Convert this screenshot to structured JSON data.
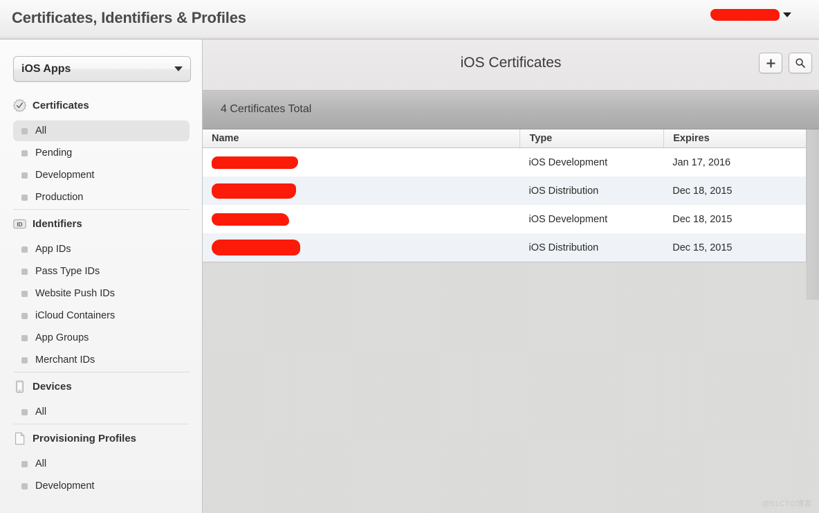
{
  "titlebar": {
    "app_title": "Certificates, Identifiers & Profiles",
    "account_redacted": "",
    "caret_icon": "chevron-down-icon"
  },
  "sidebar": {
    "team_selector": {
      "label": "iOS Apps",
      "caret_icon": "chevron-down-icon"
    },
    "groups": [
      {
        "name": "Certificates",
        "icon": "certificate-seal-icon",
        "items": [
          {
            "label": "All",
            "selected": true
          },
          {
            "label": "Pending",
            "selected": false
          },
          {
            "label": "Development",
            "selected": false
          },
          {
            "label": "Production",
            "selected": false
          }
        ]
      },
      {
        "name": "Identifiers",
        "icon": "id-badge-icon",
        "items": [
          {
            "label": "App IDs",
            "selected": false
          },
          {
            "label": "Pass Type IDs",
            "selected": false
          },
          {
            "label": "Website Push IDs",
            "selected": false
          },
          {
            "label": "iCloud Containers",
            "selected": false
          },
          {
            "label": "App Groups",
            "selected": false
          },
          {
            "label": "Merchant IDs",
            "selected": false
          }
        ]
      },
      {
        "name": "Devices",
        "icon": "device-phone-icon",
        "items": [
          {
            "label": "All",
            "selected": false
          }
        ]
      },
      {
        "name": "Provisioning Profiles",
        "icon": "document-page-icon",
        "items": [
          {
            "label": "All",
            "selected": false
          },
          {
            "label": "Development",
            "selected": false
          }
        ]
      }
    ]
  },
  "main": {
    "page_title": "iOS Certificates",
    "add_button_icon": "plus-icon",
    "search_button_icon": "search-icon",
    "total_text": "4 Certificates Total",
    "table": {
      "columns": [
        "Name",
        "Type",
        "Expires"
      ],
      "rows": [
        {
          "name": "",
          "type": "iOS Development",
          "expires": "Jan 17, 2016"
        },
        {
          "name": "",
          "type": "iOS Distribution",
          "expires": "Dec 18, 2015"
        },
        {
          "name": "",
          "type": "iOS Development",
          "expires": "Dec 18, 2015"
        },
        {
          "name": "",
          "type": "iOS Distribution",
          "expires": "Dec 15, 2015"
        }
      ]
    }
  },
  "watermark": {
    "text": "@51CTO博客"
  },
  "colors": {
    "redaction": "#fc1a08",
    "selected_row": "#e4e4e4",
    "alt_row": "#eff2f6"
  }
}
